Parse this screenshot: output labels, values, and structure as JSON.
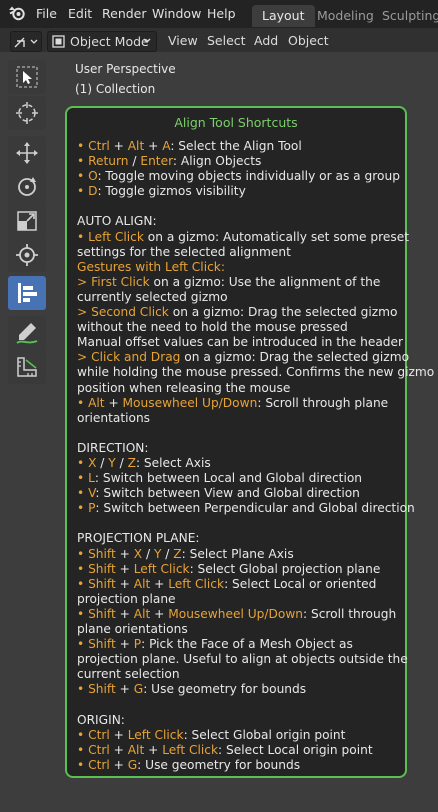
{
  "menus": [
    "File",
    "Edit",
    "Render",
    "Window",
    "Help"
  ],
  "workspace_tabs": [
    "Layout",
    "Modeling",
    "Sculpting"
  ],
  "header": {
    "mode": "Object Mode",
    "buttons": [
      "View",
      "Select",
      "Add",
      "Object"
    ]
  },
  "viewport": {
    "perspective": "User Perspective",
    "collection": "(1) Collection"
  },
  "toolbar_tools": [
    "select-box",
    "cursor",
    "move",
    "rotate",
    "scale",
    "transform",
    "align-tool",
    "annotate",
    "measure"
  ],
  "panel": {
    "title": "Align Tool Shortcuts",
    "border_color": "#5bbf52",
    "accent_color": "#e7a336",
    "lines": [
      [
        [
          "• Ctrl",
          true
        ],
        [
          " + ",
          false
        ],
        [
          "Alt",
          true
        ],
        [
          " + ",
          false
        ],
        [
          "A",
          true
        ],
        [
          ": Select the Align Tool",
          false
        ]
      ],
      [
        [
          "• Return",
          true
        ],
        [
          " / ",
          false
        ],
        [
          "Enter",
          true
        ],
        [
          ": Align Objects",
          false
        ]
      ],
      [
        [
          "• O",
          true
        ],
        [
          ": Toggle moving objects individually or as a group",
          false
        ]
      ],
      [
        [
          "• D",
          true
        ],
        [
          ": Toggle gizmos visibility",
          false
        ]
      ],
      [],
      [
        [
          "AUTO ALIGN:",
          false
        ]
      ],
      [
        [
          "• Left Click",
          true
        ],
        [
          " on a gizmo: Automatically set some preset",
          false
        ]
      ],
      [
        [
          "settings for the selected alignment",
          false
        ]
      ],
      [
        [
          "Gestures with Left Click:",
          true
        ]
      ],
      [
        [
          "> First Click",
          true
        ],
        [
          " on a gizmo: Use the alignment of the",
          false
        ]
      ],
      [
        [
          "currently selected gizmo",
          false
        ]
      ],
      [
        [
          "> Second Click",
          true
        ],
        [
          " on a gizmo: Drag the selected gizmo",
          false
        ]
      ],
      [
        [
          "without the need to hold the mouse pressed",
          false
        ]
      ],
      [
        [
          "Manual offset values can be introduced in the header",
          false
        ]
      ],
      [
        [
          "> Click and Drag",
          true
        ],
        [
          " on a gizmo: Drag the selected gizmo",
          false
        ]
      ],
      [
        [
          "while holding the mouse pressed. Confirms the new gizmo",
          false
        ]
      ],
      [
        [
          "position when releasing the mouse",
          false
        ]
      ],
      [
        [
          "• Alt",
          true
        ],
        [
          " + ",
          false
        ],
        [
          "Mousewheel Up/Down",
          true
        ],
        [
          ": Scroll through plane",
          false
        ]
      ],
      [
        [
          "orientations",
          false
        ]
      ],
      [],
      [
        [
          "DIRECTION:",
          false
        ]
      ],
      [
        [
          "• X",
          true
        ],
        [
          " / ",
          false
        ],
        [
          "Y",
          true
        ],
        [
          " / ",
          false
        ],
        [
          "Z",
          true
        ],
        [
          ": Select Axis",
          false
        ]
      ],
      [
        [
          "• L",
          true
        ],
        [
          ": Switch between Local and Global direction",
          false
        ]
      ],
      [
        [
          "• V",
          true
        ],
        [
          ": Switch between View and Global direction",
          false
        ]
      ],
      [
        [
          "• P",
          true
        ],
        [
          ": Switch between Perpendicular and Global direction",
          false
        ]
      ],
      [],
      [
        [
          "PROJECTION PLANE:",
          false
        ]
      ],
      [
        [
          "• Shift",
          true
        ],
        [
          " + ",
          false
        ],
        [
          "X",
          true
        ],
        [
          " / ",
          false
        ],
        [
          "Y",
          true
        ],
        [
          " / ",
          false
        ],
        [
          "Z",
          true
        ],
        [
          ": Select Plane Axis",
          false
        ]
      ],
      [
        [
          "• Shift",
          true
        ],
        [
          " + ",
          false
        ],
        [
          "Left Click",
          true
        ],
        [
          ": Select Global projection plane",
          false
        ]
      ],
      [
        [
          "• Shift",
          true
        ],
        [
          " + ",
          false
        ],
        [
          "Alt",
          true
        ],
        [
          " + ",
          false
        ],
        [
          "Left Click",
          true
        ],
        [
          ": Select Local or oriented",
          false
        ]
      ],
      [
        [
          "projection plane",
          false
        ]
      ],
      [
        [
          "• Shift",
          true
        ],
        [
          " + ",
          false
        ],
        [
          "Alt",
          true
        ],
        [
          " + ",
          false
        ],
        [
          "Mousewheel Up/Down",
          true
        ],
        [
          ": Scroll through",
          false
        ]
      ],
      [
        [
          "plane orientations",
          false
        ]
      ],
      [
        [
          "• Shift",
          true
        ],
        [
          " + ",
          false
        ],
        [
          "P",
          true
        ],
        [
          ": Pick the Face of a Mesh Object as",
          false
        ]
      ],
      [
        [
          "projection plane. Useful to align at objects outside the",
          false
        ]
      ],
      [
        [
          "current selection",
          false
        ]
      ],
      [
        [
          "• Shift",
          true
        ],
        [
          " + ",
          false
        ],
        [
          "G",
          true
        ],
        [
          ": Use geometry for bounds",
          false
        ]
      ],
      [],
      [
        [
          "ORIGIN:",
          false
        ]
      ],
      [
        [
          "• Ctrl",
          true
        ],
        [
          " + ",
          false
        ],
        [
          "Left Click",
          true
        ],
        [
          ": Select Global origin point",
          false
        ]
      ],
      [
        [
          "• Ctrl",
          true
        ],
        [
          " + ",
          false
        ],
        [
          "Alt",
          true
        ],
        [
          " + ",
          false
        ],
        [
          "Left Click",
          true
        ],
        [
          ": Select Local origin point",
          false
        ]
      ],
      [
        [
          "• Ctrl",
          true
        ],
        [
          " + ",
          false
        ],
        [
          "G",
          true
        ],
        [
          ": Use geometry for bounds",
          false
        ]
      ]
    ]
  }
}
